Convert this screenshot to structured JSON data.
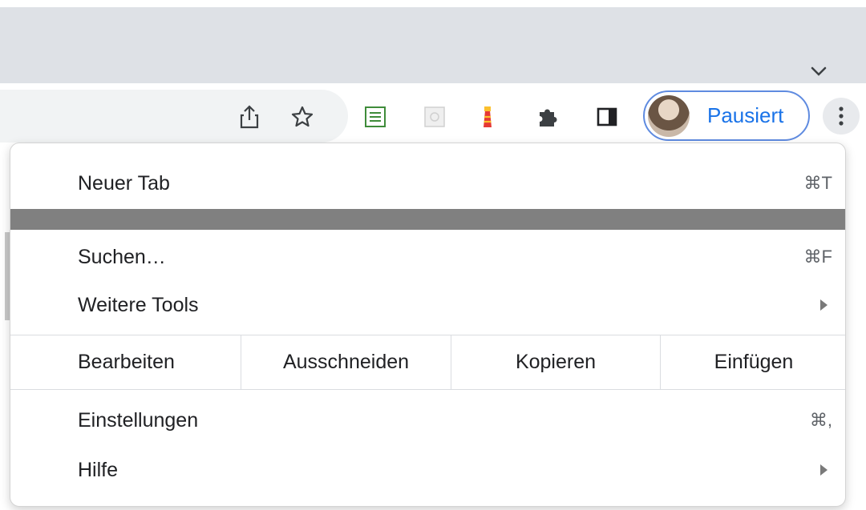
{
  "browser": {
    "profile": {
      "status_label": "Pausiert"
    },
    "toolbar_icons": [
      "share-icon",
      "bookmark-star-icon",
      "ext-notes-icon",
      "ext-grid-icon",
      "ext-lighthouse-icon",
      "puzzle-icon",
      "side-panel-icon"
    ]
  },
  "menu": {
    "new_tab": {
      "label": "Neuer Tab",
      "shortcut": "⌘T"
    },
    "find": {
      "label": "Suchen…",
      "shortcut": "⌘F"
    },
    "more_tools": {
      "label": "Weitere Tools"
    },
    "edit": {
      "label": "Bearbeiten",
      "cut": "Ausschneiden",
      "copy": "Kopieren",
      "paste": "Einfügen"
    },
    "settings": {
      "label": "Einstellungen",
      "shortcut": "⌘,"
    },
    "help": {
      "label": "Hilfe"
    }
  },
  "colors": {
    "accent": "#1a73e8",
    "tabstrip": "#dee1e6",
    "highlight_band": "#808080"
  }
}
